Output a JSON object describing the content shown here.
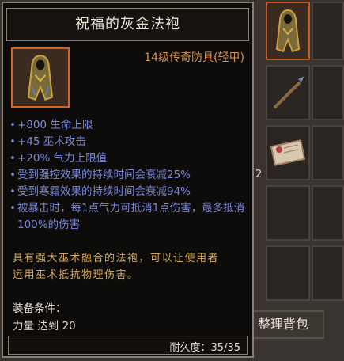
{
  "tooltip": {
    "title": "祝福的灰金法袍",
    "item_type": "14级传奇防具(轻甲)",
    "item_icon": "robe-icon",
    "stats": [
      "+800 生命上限",
      "+45 巫术攻击",
      "+20% 气力上限值",
      "受到强控效果的持续时间会衰减25%",
      "受到寒霜效果的持续时间会衰减94%",
      "被暴击时，每1点气力可抵消1点伤害，最多抵消100%的伤害"
    ],
    "stat_bullet": "•",
    "flavor_line1": "具有强大巫术融合的法袍，可以让使用者",
    "flavor_line2": "运用巫术抵抗物理伤害。",
    "requirement_label": "装备条件：",
    "requirement_value": "力量 达到 20",
    "durability": "耐久度：35/35"
  },
  "inventory": {
    "sort_button": "整理背包",
    "side_number": "2"
  },
  "colors": {
    "stat_blue": "#7a87d8",
    "type_orange": "#d9914a",
    "flavor_gold": "#d2a85a",
    "active_border": "#d0652b"
  }
}
